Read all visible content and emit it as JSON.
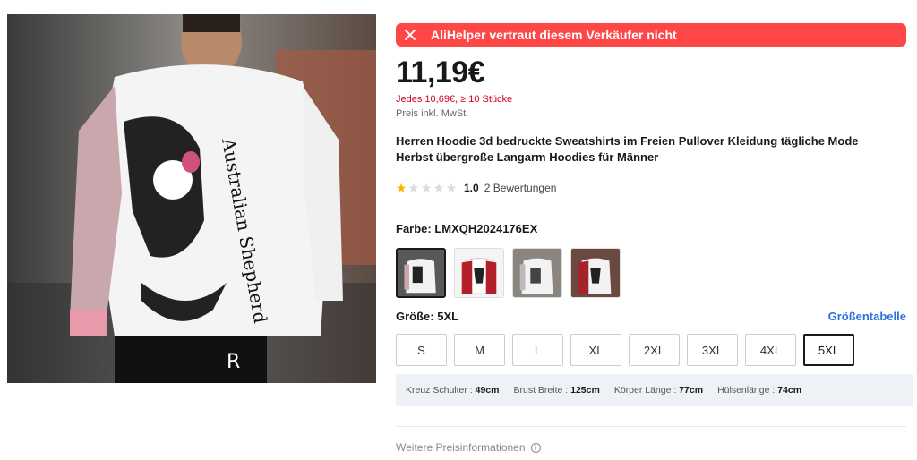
{
  "product": {
    "image_alt": "product-photo",
    "warning": "AliHelper vertraut diesem Verkäufer nicht",
    "price": "11,19€",
    "bulk_price": "Jedes 10,69€, ≥ 10 Stücke",
    "tax_note": "Preis inkl. MwSt.",
    "title": "Herren Hoodie 3d bedruckte Sweatshirts im Freien Pullover Kleidung tägliche Mode Herbst übergroße Langarm Hoodies für Männer",
    "rating": {
      "score": "1.0",
      "count_label": "2 Bewertungen",
      "stars_filled": 1,
      "stars_total": 5
    },
    "color": {
      "label": "Farbe: LMXQH2024176EX",
      "selected_index": 0,
      "option_count": 4
    },
    "size": {
      "label": "Größe: 5XL",
      "chart_link": "Größentabelle",
      "options": [
        "S",
        "M",
        "L",
        "XL",
        "2XL",
        "3XL",
        "4XL",
        "5XL"
      ],
      "selected": "5XL"
    },
    "measurements": [
      {
        "label": "Kreuz Schulter :",
        "value": "49cm"
      },
      {
        "label": "Brust Breite :",
        "value": "125cm"
      },
      {
        "label": "Körper Länge :",
        "value": "77cm"
      },
      {
        "label": "Hülsenlänge :",
        "value": "74cm"
      }
    ],
    "more_info": "Weitere Preisinformationen",
    "colors": {
      "accent_red": "#ff4747",
      "price_red": "#d3031c",
      "link_blue": "#2e6fe0",
      "star_gold": "#ffb400"
    }
  }
}
